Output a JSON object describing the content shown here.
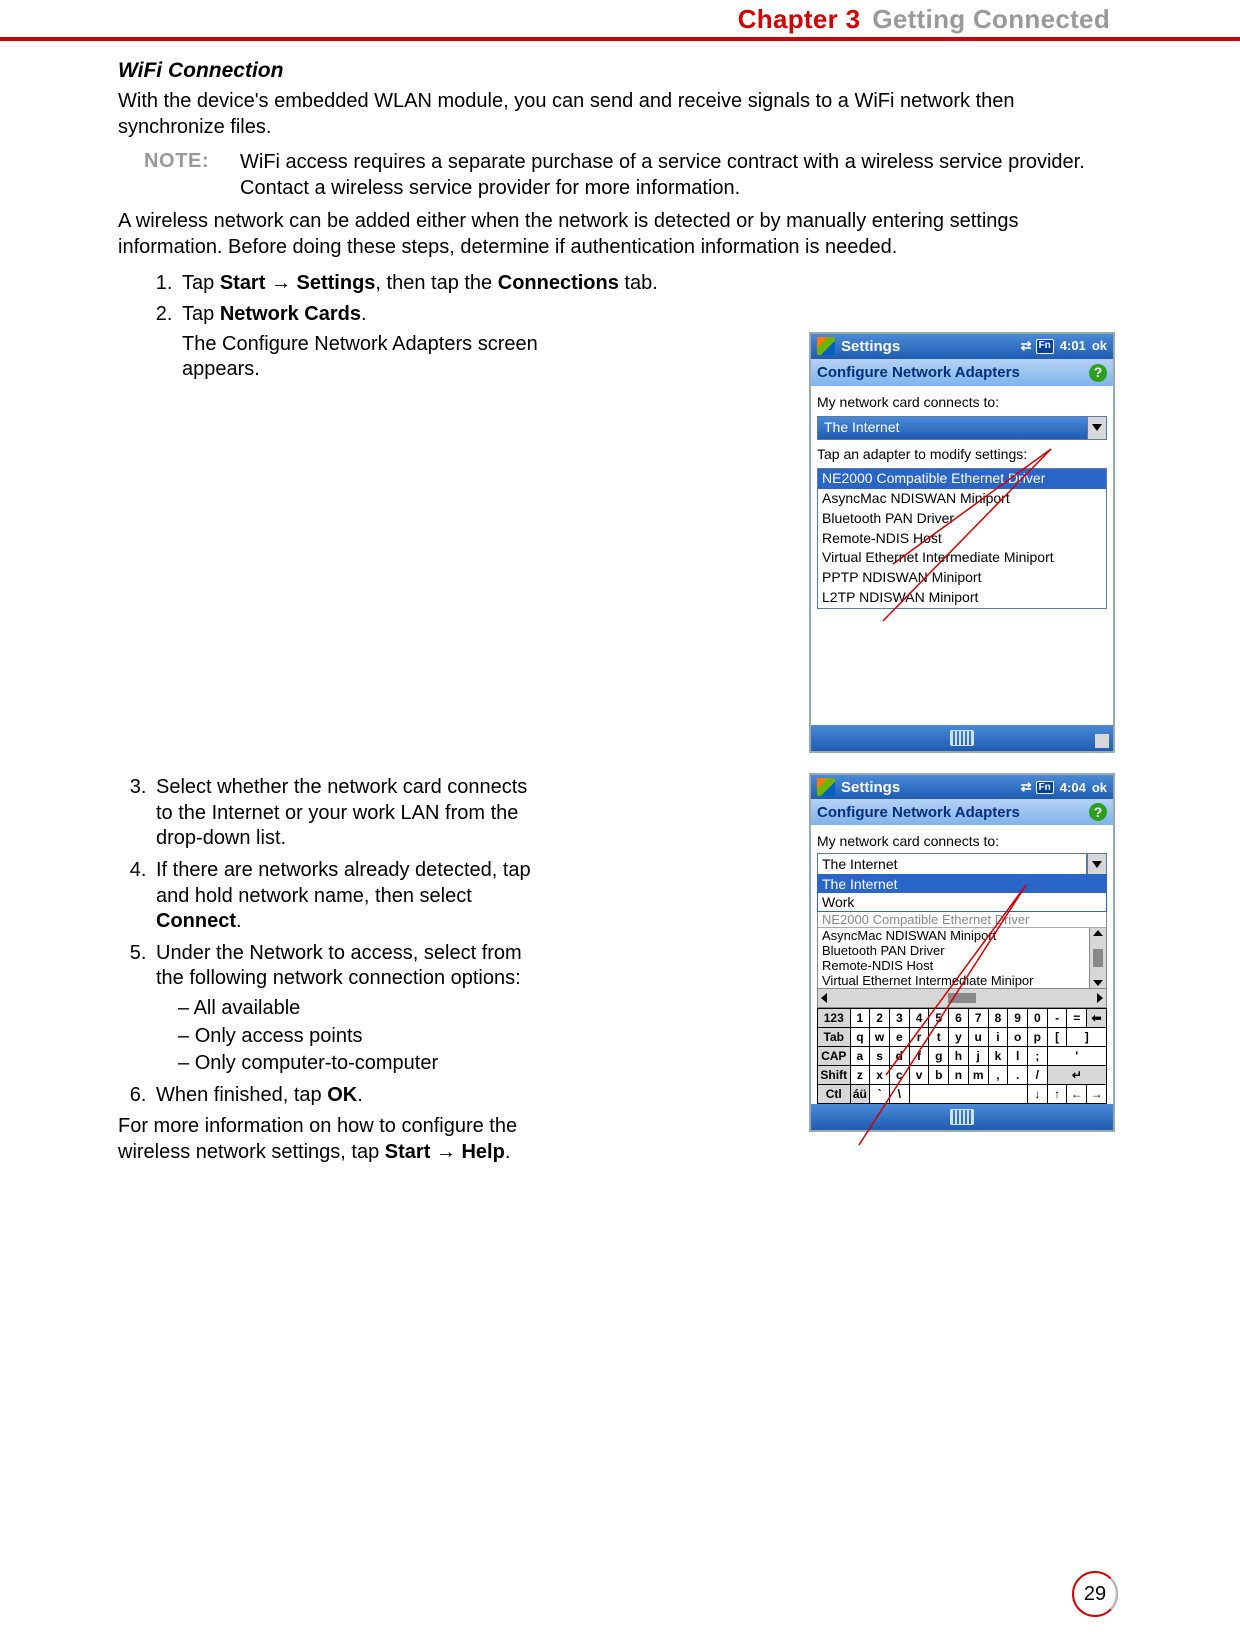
{
  "header": {
    "chapter": "Chapter 3",
    "title": "Getting Connected"
  },
  "page_number": "29",
  "section_title": "WiFi Connection",
  "intro": "With the device's embedded WLAN module, you can send and receive signals to a WiFi network then synchronize files.",
  "note_label": "NOTE:",
  "note_text": "WiFi access requires a separate purchase of a service contract with a wireless service provider. Contact a wireless service provider for more information.",
  "para2": "A wireless network can be added either when the network is detected or by manually entering settings information. Before doing these steps, determine if authentication information is needed.",
  "steps": {
    "s1_a": "Tap ",
    "s1_b": "Start",
    "s1_arrow": " → ",
    "s1_c": "Settings",
    "s1_d": ", then tap the ",
    "s1_e": "Connections",
    "s1_f": " tab.",
    "s2_a": "Tap ",
    "s2_b": "Network Cards",
    "s2_c": ".",
    "s2_sub": "The Configure Network Adapters screen appears.",
    "s3": "Select whether the network card connects to the Internet or your work LAN from the drop-down list.",
    "s4_a": "If there are networks already detected, tap and hold network name, then select ",
    "s4_b": "Connect",
    "s4_c": ".",
    "s5": "Under the Network to access, select from the following network connection options:",
    "s5_opts": [
      "All available",
      "Only access points",
      "Only computer-to-computer"
    ],
    "s6_a": "When finished, tap ",
    "s6_b": "OK",
    "s6_c": "."
  },
  "footer_a": "For more information on how to configure the wireless network settings, tap ",
  "footer_b": "Start",
  "footer_arrow": " → ",
  "footer_c": "Help",
  "footer_d": ".",
  "shot1": {
    "app": "Settings",
    "time": "4:01",
    "ok": "ok",
    "fn": "Fn",
    "heading": "Configure Network Adapters",
    "label1": "My network card connects to:",
    "combo": "The Internet",
    "label2": "Tap an adapter to modify settings:",
    "adapters": [
      "NE2000 Compatible Ethernet Driver",
      "AsyncMac NDISWAN Miniport",
      "Bluetooth PAN Driver",
      "Remote-NDIS Host",
      "Virtual Ethernet Intermediate Miniport",
      "PPTP NDISWAN Miniport",
      "L2TP NDISWAN Miniport"
    ]
  },
  "shot2": {
    "app": "Settings",
    "time": "4:04",
    "ok": "ok",
    "fn": "Fn",
    "heading": "Configure Network Adapters",
    "label1": "My network card connects to:",
    "combo": "The Internet",
    "options": [
      "The Internet",
      "Work"
    ],
    "adapters_ghost": "NE2000 Compatible Ethernet Driver",
    "adapters": [
      "AsyncMac NDISWAN Miniport",
      "Bluetooth PAN Driver",
      "Remote-NDIS Host",
      "Virtual Ethernet Intermediate Minipor"
    ],
    "kb": {
      "r1": [
        "123",
        "1",
        "2",
        "3",
        "4",
        "5",
        "6",
        "7",
        "8",
        "9",
        "0",
        "-",
        "=",
        "⬅"
      ],
      "r2": [
        "Tab",
        "q",
        "w",
        "e",
        "r",
        "t",
        "y",
        "u",
        "i",
        "o",
        "p",
        "[",
        "]"
      ],
      "r3": [
        "CAP",
        "a",
        "s",
        "d",
        "f",
        "g",
        "h",
        "j",
        "k",
        "l",
        ";",
        "'"
      ],
      "r4": [
        "Shift",
        "z",
        "x",
        "c",
        "v",
        "b",
        "n",
        "m",
        ",",
        ".",
        "/",
        "↵"
      ],
      "r5": [
        "Ctl",
        "áü",
        "`",
        "\\",
        " ",
        "↓",
        "↑",
        "←",
        "→"
      ]
    }
  }
}
